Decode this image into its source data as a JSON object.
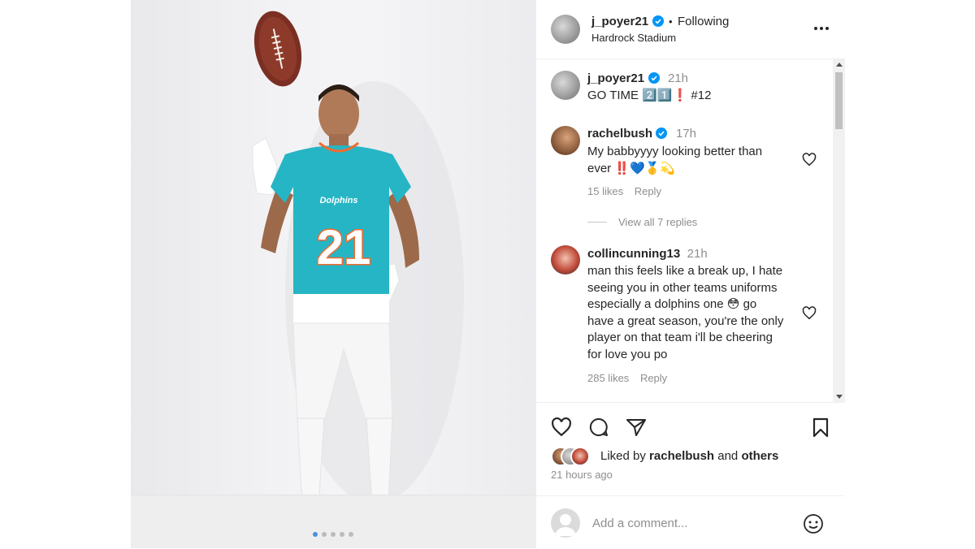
{
  "post": {
    "author": "j_poyer21",
    "separator": "•",
    "follow_status": "Following",
    "location": "Hardrock Stadium",
    "more_icon": "more-horizontal-icon"
  },
  "caption": {
    "username": "j_poyer21",
    "time": "21h",
    "text": "GO TIME 2️⃣1️⃣❗ #12"
  },
  "comments": [
    {
      "username": "rachelbush",
      "time": "17h",
      "line1": "My babbyyyy looking better than",
      "line2": "ever ‼️💙🥇💫",
      "likes": "15 likes",
      "reply": "Reply",
      "view_replies": "View all 7 replies"
    },
    {
      "username": "collincunning13",
      "time": "21h",
      "lines": [
        "man this feels like a break up, I hate",
        "seeing you in other teams uniforms",
        "especially a dolphins one 😳 go",
        "have a great season, you're the only",
        "player on that team i'll be cheering",
        "for love you po"
      ],
      "likes": "285 likes",
      "reply": "Reply"
    }
  ],
  "actions": {
    "liked_prefix": "Liked by",
    "liked_user": "rachelbush",
    "liked_and": "and",
    "liked_others": "others",
    "timestamp": "21 hours ago"
  },
  "add_comment": {
    "placeholder": "Add a comment..."
  },
  "photo": {
    "jersey_team": "Dolphins",
    "jersey_number": "21"
  },
  "colors": {
    "verified": "#0095f6",
    "jersey": "#26b5c4",
    "jersey_orange": "#f26a2e"
  }
}
